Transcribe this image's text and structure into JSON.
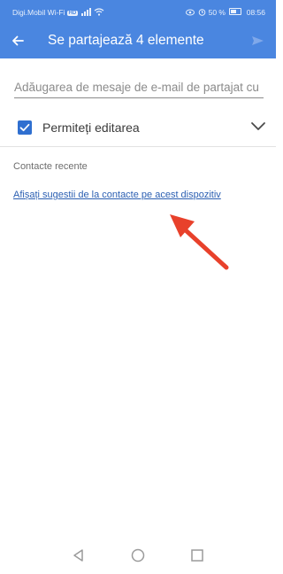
{
  "status_bar": {
    "carrier": "Digi.Mobil Wi-Fi",
    "volte_badge": "HD",
    "battery_text": "50 %",
    "time": "08:56"
  },
  "app_bar": {
    "title": "Se partajează 4 elemente",
    "back_icon": "arrow-left-icon",
    "send_icon": "send-icon"
  },
  "share_form": {
    "email_placeholder": "Adăugarea de mesaje de e-mail de partajat cu",
    "email_value": "",
    "allow_editing_label": "Permiteți editarea",
    "allow_editing_checked": true
  },
  "recent_contacts": {
    "header": "Contacte recente",
    "suggestions_link": "Afișați sugestii de la contacte pe acest dispozitiv"
  },
  "nav_bar": {
    "icons": [
      "back-triangle-icon",
      "home-circle-icon",
      "recents-square-icon"
    ]
  },
  "colors": {
    "app_bar": "#4a86e0",
    "checkbox": "#2f6fd0",
    "link": "#2b5fb2",
    "annotation_arrow": "#e8412b"
  }
}
